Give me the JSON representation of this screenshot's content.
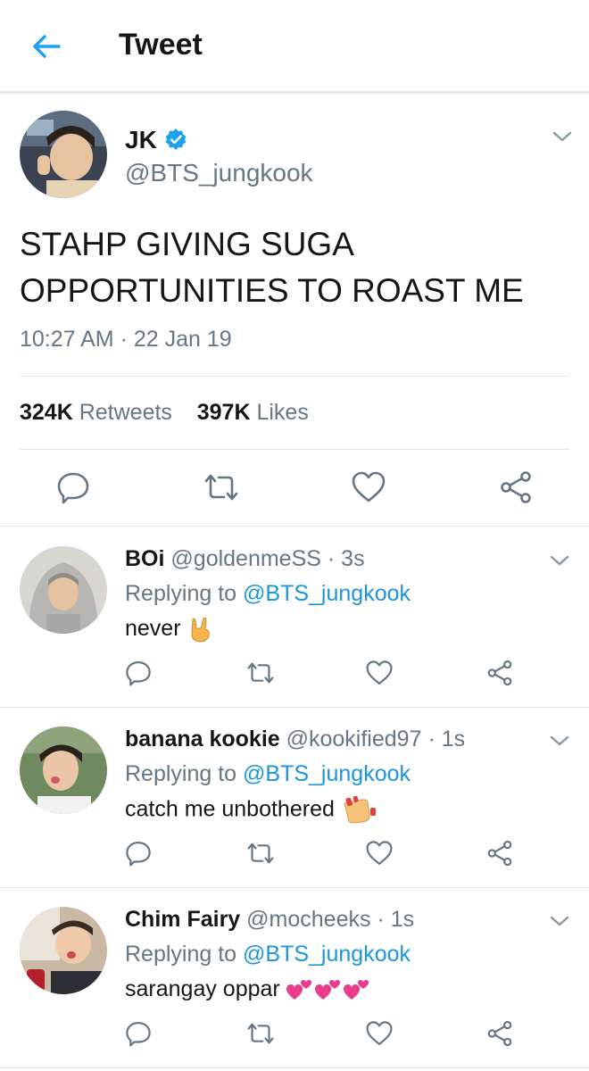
{
  "header": {
    "title": "Tweet"
  },
  "tweet": {
    "author_name": "JK",
    "author_handle": "@BTS_jungkook",
    "verified": true,
    "text_line1": "STAHP GIVING SUGA",
    "text_line2": "OPPORTUNITIES TO ROAST ME",
    "timestamp": "10:27 AM · 22 Jan 19",
    "retweets_count": "324K",
    "retweets_label": "Retweets",
    "likes_count": "397K",
    "likes_label": "Likes"
  },
  "replies": [
    {
      "name": "BOi",
      "handle": "@goldenmeSS",
      "time": "· 3s",
      "replying_prefix": "Replying to",
      "replying_to": "@BTS_jungkook",
      "text": "never",
      "emoji": "sign-of-horns-emoji"
    },
    {
      "name": "banana kookie",
      "handle": "@kookified97",
      "time": "· 1s",
      "replying_prefix": "Replying to",
      "replying_to": "@BTS_jungkook",
      "text": "catch me unbothered",
      "emoji": "nail-polish-emoji"
    },
    {
      "name": "Chim Fairy",
      "handle": "@mocheeks",
      "time": "· 1s",
      "replying_prefix": "Replying to",
      "replying_to": "@BTS_jungkook",
      "text": "sarangay oppar",
      "emoji": "two-hearts-emoji"
    }
  ],
  "colors": {
    "accent": "#1da1f2",
    "link": "#1b95e0",
    "muted": "#657786",
    "text": "#14171a",
    "divider": "#e1e8ed"
  }
}
